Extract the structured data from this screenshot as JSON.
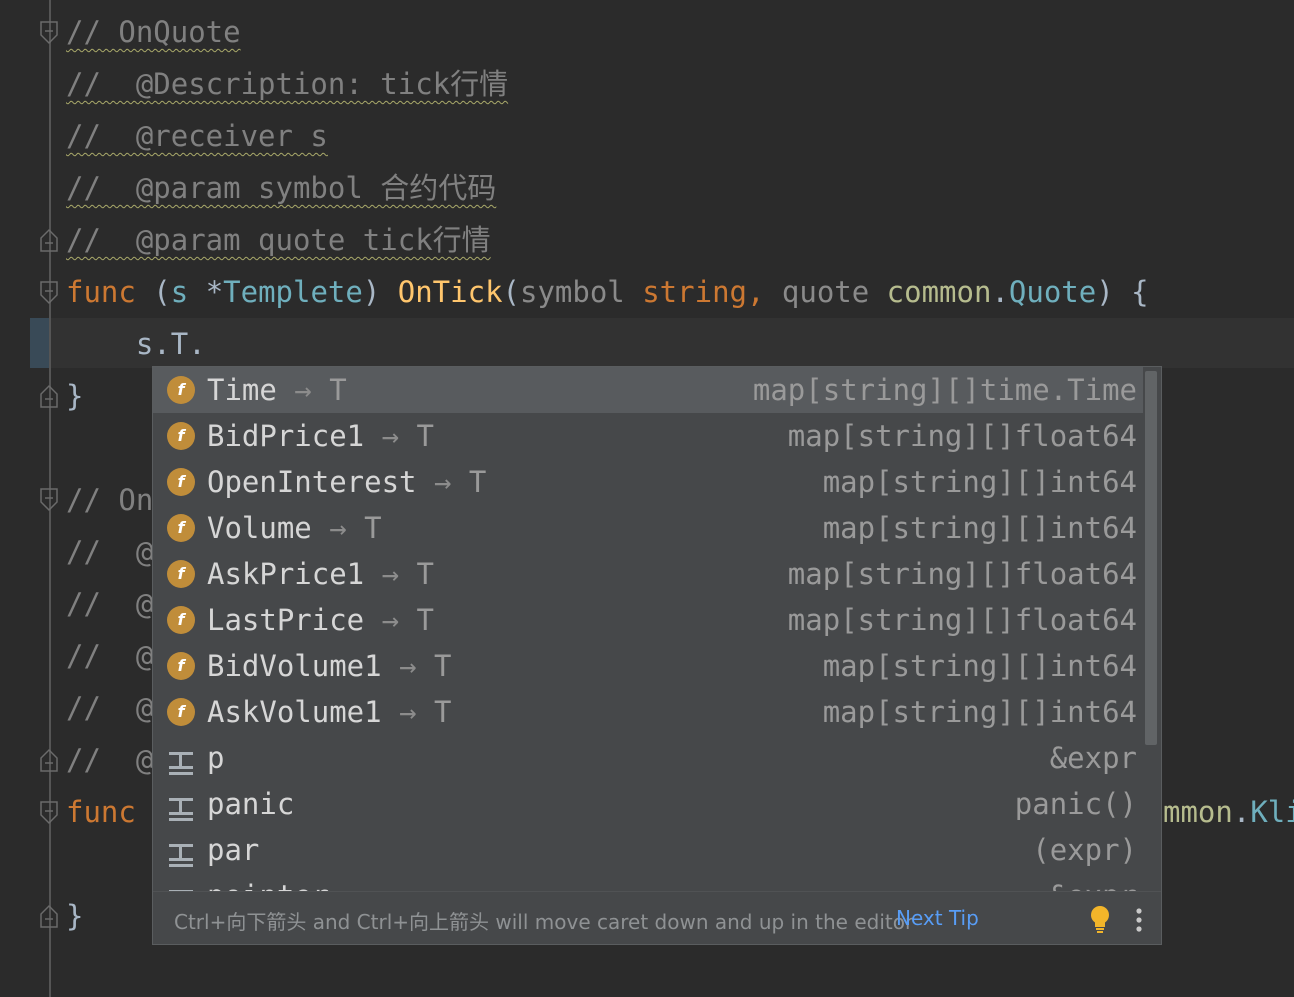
{
  "editor": {
    "lines": {
      "l1_comment": "// OnQuote",
      "l2_comment": "//  @Description: tick行情",
      "l3_comment": "//  @receiver s",
      "l4_comment": "//  @param symbol 合约代码",
      "l5_comment": "//  @param quote tick行情",
      "l6_func_kw": "func",
      "l6_open": " (",
      "l6_recv": "s",
      "l6_star": " *",
      "l6_type": "Templete",
      "l6_close": ") ",
      "l6_name": "OnTick",
      "l6_paren": "(",
      "l6_p1": "symbol",
      "l6_p1type": " string",
      "l6_comma": ", ",
      "l6_p2": "quote",
      "l6_p2pkg": " common",
      "l6_dot": ".",
      "l6_p2type": "Quote",
      "l6_end": ") {",
      "l7_code": "    s.T.",
      "l8_brace": "}",
      "l10_comment": "// On",
      "l11_comment": "//  @",
      "l12_comment": "//  @",
      "l13_comment": "//  @",
      "l14_comment": "//  @",
      "l15_comment": "//  @",
      "l16_func_kw": "func",
      "l16_tail_pkg": "mmon",
      "l16_tail_dot": ".",
      "l16_tail_type": "Kli",
      "l18_brace": "}"
    }
  },
  "completion": {
    "items": [
      {
        "icon": "field-icon",
        "name": "Time",
        "arrow": " → ",
        "receiver": "T",
        "type": "map[string][]time.Time",
        "selected": true
      },
      {
        "icon": "field-icon",
        "name": "BidPrice1",
        "arrow": " → ",
        "receiver": "T",
        "type": "map[string][]float64"
      },
      {
        "icon": "field-icon",
        "name": "OpenInterest",
        "arrow": " → ",
        "receiver": "T",
        "type": "map[string][]int64"
      },
      {
        "icon": "field-icon",
        "name": "Volume",
        "arrow": " → ",
        "receiver": "T",
        "type": "map[string][]int64"
      },
      {
        "icon": "field-icon",
        "name": "AskPrice1",
        "arrow": " → ",
        "receiver": "T",
        "type": "map[string][]float64"
      },
      {
        "icon": "field-icon",
        "name": "LastPrice",
        "arrow": " → ",
        "receiver": "T",
        "type": "map[string][]float64"
      },
      {
        "icon": "field-icon",
        "name": "BidVolume1",
        "arrow": " → ",
        "receiver": "T",
        "type": "map[string][]int64"
      },
      {
        "icon": "field-icon",
        "name": "AskVolume1",
        "arrow": " → ",
        "receiver": "T",
        "type": "map[string][]int64"
      },
      {
        "icon": "postfix-template-icon",
        "name": "p",
        "type": "&expr"
      },
      {
        "icon": "postfix-template-icon",
        "name": "panic",
        "type": "panic()"
      },
      {
        "icon": "postfix-template-icon",
        "name": "par",
        "type": "(expr)"
      },
      {
        "icon": "postfix-template-icon",
        "name": "pointer",
        "type": "&expr"
      }
    ],
    "field_icon_letter": "f",
    "tip_text": "Ctrl+向下箭头 and Ctrl+向上箭头 will move caret down and up in the editor",
    "tip_link": "Next Tip"
  },
  "colors": {
    "background": "#2b2b2b",
    "popup_background": "#46484a",
    "selected_row": "#585b5e",
    "keyword": "#cc7832",
    "function": "#ffc66d",
    "type": "#6fafbd",
    "comment": "#808080",
    "link": "#589df6",
    "field_icon": "#c08d3a"
  }
}
